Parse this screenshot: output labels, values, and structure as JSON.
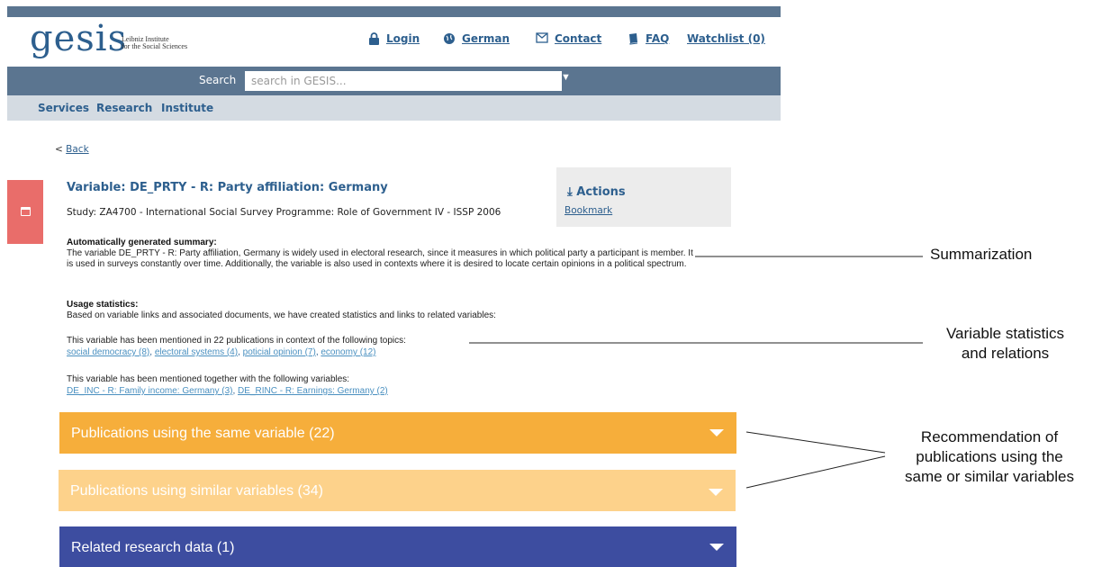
{
  "header": {
    "logo": "gesis",
    "logo_sub_line1": "Leibniz Institute",
    "logo_sub_line2": "for the Social Sciences",
    "links": {
      "login": "Login",
      "language": "German",
      "contact": "Contact",
      "faq": "FAQ",
      "watchlist": "Watchlist (0)"
    }
  },
  "search": {
    "label": "Search",
    "placeholder": "search in GESIS..."
  },
  "subnav": {
    "services": "Services",
    "research": "Research",
    "institute": "Institute"
  },
  "back": {
    "prefix": "<",
    "label": "Back"
  },
  "variable": {
    "title": "Variable: DE_PRTY - R: Party affiliation: Germany",
    "study": "Study: ZA4700 - International Social Survey Programme: Role of Government IV - ISSP 2006"
  },
  "actions": {
    "title": "Actions",
    "bookmark": "Bookmark"
  },
  "summary": {
    "heading": "Automatically generated summary:",
    "text": "The variable DE_PRTY - R: Party affiliation, Germany is widely used in electoral research, since it measures in which political party a participant is member. It is used in surveys constantly over time. Additionally, the variable is also used in contexts where it is desired to locate certain opinions in a political spectrum."
  },
  "usage": {
    "heading": "Usage statistics:",
    "intro": "Based on variable links and associated documents, we have created statistics and links to related variables:",
    "topics_text": "This variable has been mentioned in 22 publications in context of the following topics:",
    "topics": [
      "social democracy (8)",
      "electoral systems (4)",
      "poticial opinion (7)",
      "economy (12)"
    ],
    "variables_text": "This variable has been mentioned together with the following variables:",
    "variables": [
      "DE_INC - R: Family income: Germany (3)",
      "DE_RINC - R: Earnings: Germany (2)"
    ]
  },
  "panels": [
    {
      "label": "Publications using the same variable (22)",
      "color": "#f6ae3b"
    },
    {
      "label": "Publications using similar variables (34)",
      "color": "#fdd28b"
    },
    {
      "label": "Related research data (1)",
      "color": "#3d4da0"
    }
  ],
  "annotations": {
    "summarization": "Summarization",
    "stats_line1": "Variable statistics",
    "stats_line2": "and relations",
    "rec_line1": "Recommendation of",
    "rec_line2": "publications using the",
    "rec_line3": "same or similar variables"
  },
  "colors": {
    "header_bar": "#5b7590",
    "subnav_bg": "#d4dbe2",
    "link_blue": "#2d5f8e",
    "red_tab": "#e96d6a",
    "actions_bg": "#ececec"
  }
}
